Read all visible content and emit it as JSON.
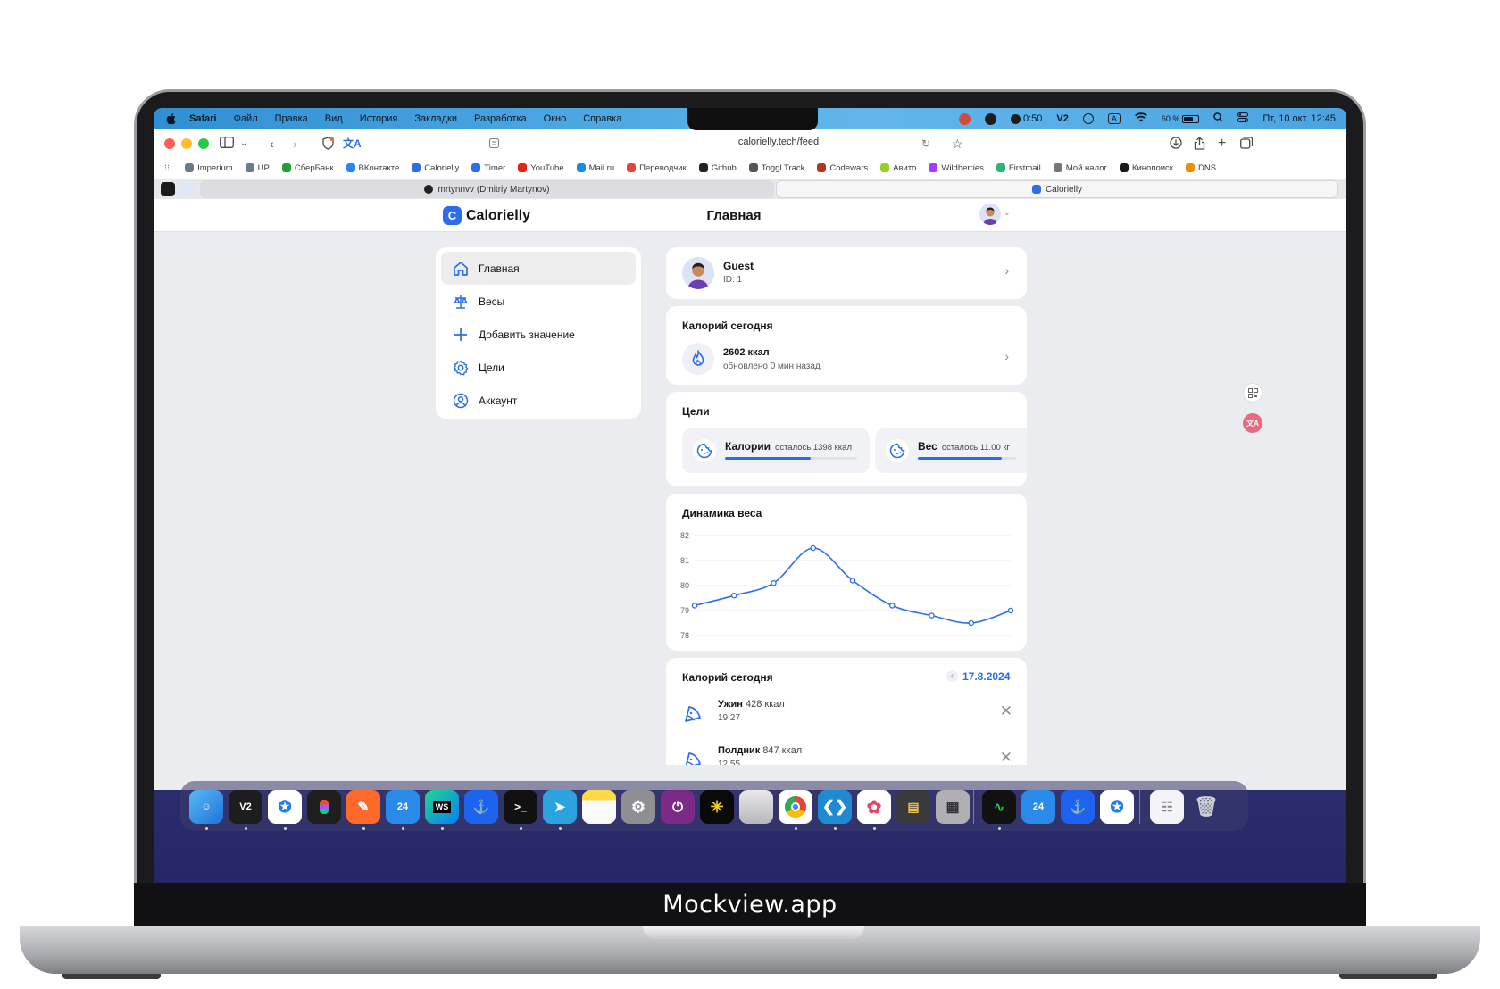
{
  "menubar": {
    "app_name": "Safari",
    "items": [
      "Файл",
      "Правка",
      "Вид",
      "История",
      "Закладки",
      "Разработка",
      "Окно",
      "Справка"
    ],
    "timer": "0:50",
    "v2": "V2",
    "input_source": "A",
    "battery": "60 %",
    "datetime": "Пт, 10 окт. 12:45"
  },
  "browser": {
    "url": "calorielly.tech/feed",
    "bookmarks": [
      {
        "label": "Imperium",
        "color": "#6c7a89"
      },
      {
        "label": "UP",
        "color": "#6c7a89"
      },
      {
        "label": "СберБанк",
        "color": "#21a038"
      },
      {
        "label": "ВКонтакте",
        "color": "#2787f5"
      },
      {
        "label": "Calorielly",
        "color": "#2c6ee8"
      },
      {
        "label": "Timer",
        "color": "#2c6ee8"
      },
      {
        "label": "YouTube",
        "color": "#e62117"
      },
      {
        "label": "Mail.ru",
        "color": "#168de2"
      },
      {
        "label": "Переводчик",
        "color": "#e0463a"
      },
      {
        "label": "Github",
        "color": "#222222"
      },
      {
        "label": "Toggl Track",
        "color": "#555555"
      },
      {
        "label": "Codewars",
        "color": "#b1361e"
      },
      {
        "label": "Авито",
        "color": "#97cf26"
      },
      {
        "label": "Wildberries",
        "color": "#a73afd"
      },
      {
        "label": "Firstmail",
        "color": "#2bb673"
      },
      {
        "label": "Мой налог",
        "color": "#777777"
      },
      {
        "label": "Кинопоиск",
        "color": "#1a1a1a"
      },
      {
        "label": "DNS",
        "color": "#f08c00"
      }
    ],
    "tabs": [
      {
        "label": "mrtynnvv (Dmitriy Martynov)"
      },
      {
        "label": "Calorielly"
      }
    ]
  },
  "app": {
    "logo": "Calorielly",
    "page_title": "Главная",
    "nav": [
      {
        "label": "Главная",
        "icon": "home-icon"
      },
      {
        "label": "Весы",
        "icon": "scales-icon"
      },
      {
        "label": "Добавить значение",
        "icon": "plus-icon"
      },
      {
        "label": "Цели",
        "icon": "gear-icon"
      },
      {
        "label": "Аккаунт",
        "icon": "user-circle-icon"
      }
    ],
    "profile": {
      "name": "Guest",
      "id": "ID: 1"
    },
    "calories_today": {
      "title": "Калорий сегодня",
      "value": "2602 ккал",
      "updated": "обновлено 0 мин назад"
    },
    "goals": {
      "title": "Цели",
      "items": [
        {
          "label": "Калории",
          "remaining": "осталось 1398 ккал",
          "progress": 0.65
        },
        {
          "label": "Вес",
          "remaining": "осталось 11.00 кг",
          "progress": 0.85
        }
      ]
    },
    "weight_dynamics": {
      "title": "Динамика веса"
    },
    "meals": {
      "title": "Калорий сегодня",
      "date": "17.8.2024",
      "items": [
        {
          "name": "Ужин",
          "kcal": "428 ккал",
          "time": "19:27"
        },
        {
          "name": "Полдник",
          "kcal": "847 ккал",
          "time": "12:55"
        }
      ]
    }
  },
  "chart_data": {
    "type": "line",
    "title": "Динамика веса",
    "xlabel": "",
    "ylabel": "",
    "ylim": [
      78,
      82
    ],
    "yticks": [
      82,
      81,
      80,
      79,
      78
    ],
    "grid": true,
    "series": [
      {
        "values": [
          79.2,
          79.6,
          80.1,
          81.5,
          80.2,
          79.2,
          78.8,
          78.5,
          79.0
        ],
        "color": "#2c6ee8"
      }
    ]
  },
  "device_label": "Mockview.app",
  "colors": {
    "accent": "#2c6ee8",
    "bg": "#ebecf0"
  }
}
